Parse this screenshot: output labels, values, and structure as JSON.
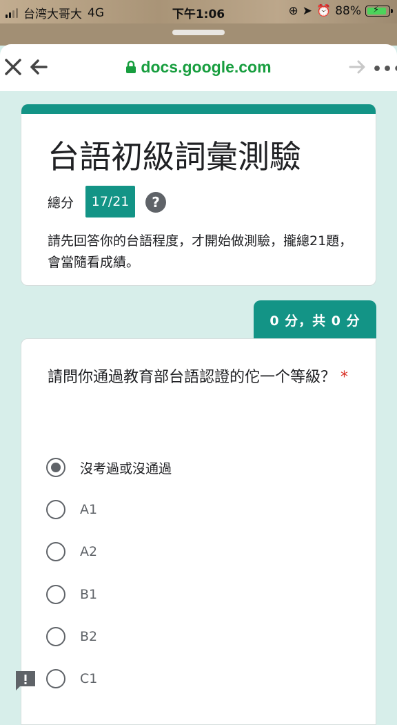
{
  "status_bar": {
    "carrier": "台湾大哥大",
    "network": "4G",
    "time": "下午1:06",
    "battery": "88%"
  },
  "browser": {
    "url": "docs.google.com"
  },
  "form": {
    "title": "台語初級詞彙測驗",
    "score_label": "總分",
    "score_value": "17/21",
    "description": "請先回答你的台語程度，才開始做測驗，攏總21題，會當隨看成績。",
    "accent_color": "#139486"
  },
  "question": {
    "points": "0 分，共 0 分",
    "text": "請問你通過教育部台語認證的佗一个等級？",
    "required_mark": "*",
    "options": [
      {
        "label": "沒考過或沒通過",
        "selected": true
      },
      {
        "label": "A1",
        "selected": false
      },
      {
        "label": "A2",
        "selected": false
      },
      {
        "label": "B1",
        "selected": false
      },
      {
        "label": "B2",
        "selected": false
      },
      {
        "label": "C1",
        "selected": false
      }
    ]
  },
  "icons": [
    "close-icon",
    "back-arrow-icon",
    "lock-icon",
    "forward-arrow-icon",
    "more-icon",
    "help-icon",
    "feedback-icon"
  ]
}
